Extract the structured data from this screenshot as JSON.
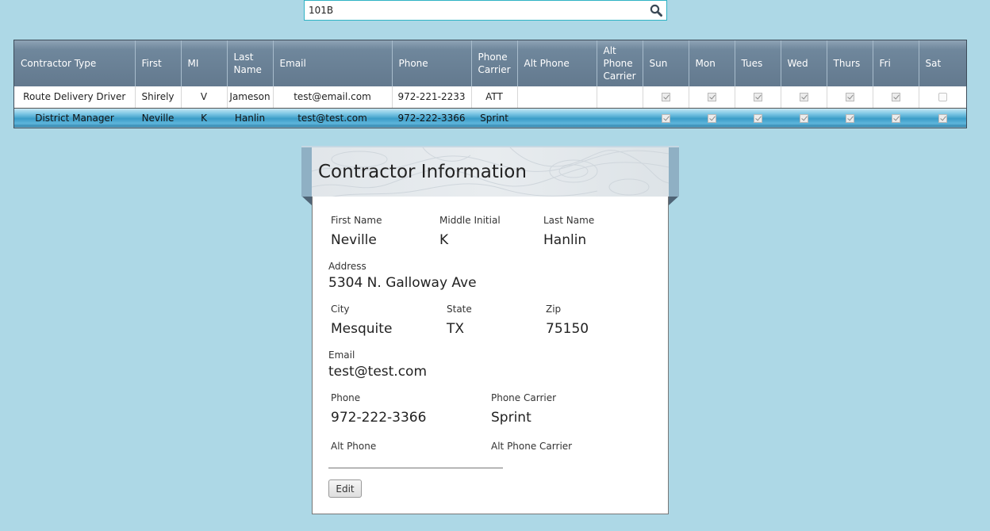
{
  "search": {
    "value": "101B",
    "icon": "search-icon"
  },
  "grid": {
    "columns": [
      "Contractor Type",
      "First",
      "MI",
      "Last Name",
      "Email",
      "Phone",
      "Phone Carrier",
      "Alt Phone",
      "Alt Phone Carrier",
      "Sun",
      "Mon",
      "Tues",
      "Wed",
      "Thurs",
      "Fri",
      "Sat"
    ],
    "rows": [
      {
        "type": "Route Delivery Driver",
        "first": "Shirely",
        "mi": "V",
        "last": "Jameson",
        "email": "test@email.com",
        "phone": "972-221-2233",
        "carrier": "ATT",
        "alt_phone": "",
        "alt_carrier": "",
        "days": [
          true,
          true,
          true,
          true,
          true,
          true,
          false
        ],
        "selected": false
      },
      {
        "type": "District Manager",
        "first": "Neville",
        "mi": "K",
        "last": "Hanlin",
        "email": "test@test.com",
        "phone": "972-222-3366",
        "carrier": "Sprint",
        "alt_phone": "",
        "alt_carrier": "",
        "days": [
          true,
          true,
          true,
          true,
          true,
          true,
          true
        ],
        "selected": true
      }
    ]
  },
  "panel": {
    "title": "Contractor Information",
    "first_name_label": "First Name",
    "first_name": "Neville",
    "middle_initial_label": "Middle Initial",
    "middle_initial": "K",
    "last_name_label": "Last Name",
    "last_name": "Hanlin",
    "address_label": "Address",
    "address": "5304 N. Galloway Ave",
    "city_label": "City",
    "city": "Mesquite",
    "state_label": "State",
    "state": "TX",
    "zip_label": "Zip",
    "zip": "75150",
    "email_label": "Email",
    "email": "test@test.com",
    "phone_label": "Phone",
    "phone": "972-222-3366",
    "phone_carrier_label": "Phone Carrier",
    "phone_carrier": "Sprint",
    "alt_phone_label": "Alt Phone",
    "alt_phone": "",
    "alt_phone_carrier_label": "Alt Phone Carrier",
    "alt_phone_carrier": "",
    "edit_label": "Edit"
  },
  "colors": {
    "background": "#add8e6",
    "header": "#6f879c",
    "selected_row": "#3b9dc8",
    "search_border": "#2fb3c4"
  }
}
